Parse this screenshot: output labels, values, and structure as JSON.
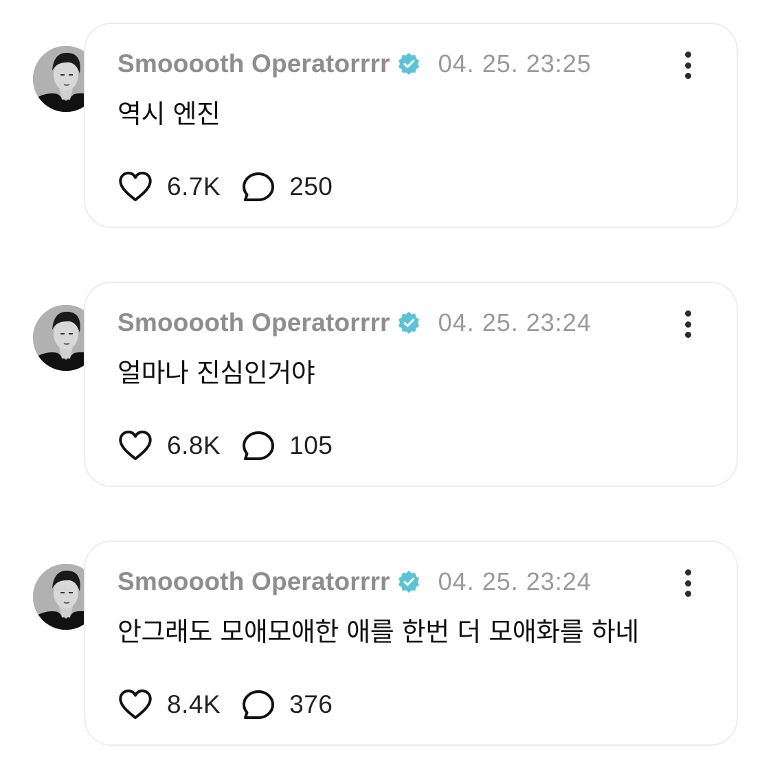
{
  "colors": {
    "verified_badge": "#5bc3d6",
    "author_name": "#8e8e8e",
    "timestamp": "#9a9a9a",
    "card_border": "#ececec"
  },
  "posts": [
    {
      "author": "Smooooth Operatorrrr",
      "verified_icon": "verified-badge-icon",
      "timestamp": "04. 25. 23:25",
      "text": "역시 엔진",
      "likes": "6.7K",
      "replies": "250"
    },
    {
      "author": "Smooooth Operatorrrr",
      "verified_icon": "verified-badge-icon",
      "timestamp": "04. 25. 23:24",
      "text": "얼마나 진심인거야",
      "likes": "6.8K",
      "replies": "105"
    },
    {
      "author": "Smooooth Operatorrrr",
      "verified_icon": "verified-badge-icon",
      "timestamp": "04. 25. 23:24",
      "text": "안그래도 모애모애한 애를 한번 더 모애화를 하네",
      "likes": "8.4K",
      "replies": "376"
    }
  ]
}
